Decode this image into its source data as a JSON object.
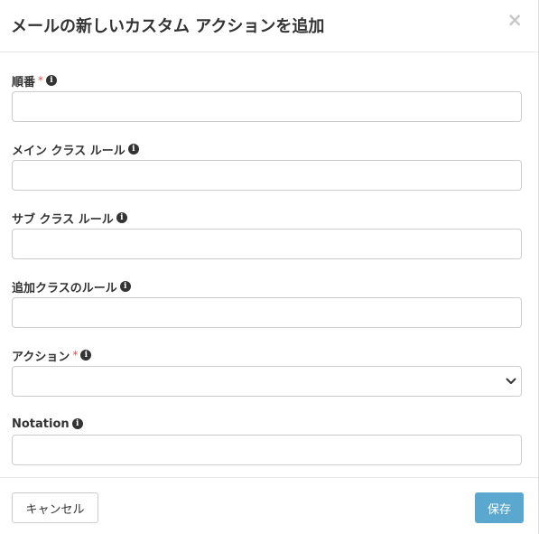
{
  "dialog": {
    "title": "メールの新しいカスタム アクションを追加",
    "close_symbol": "×"
  },
  "fields": [
    {
      "label": "順番",
      "required_mark": "*",
      "value": "",
      "type": "text"
    },
    {
      "label": "メイン クラス ルール",
      "required_mark": "",
      "value": "",
      "type": "text"
    },
    {
      "label": "サブ クラス ルール",
      "required_mark": "",
      "value": "",
      "type": "text"
    },
    {
      "label": "追加クラスのルール",
      "required_mark": "",
      "value": "",
      "type": "text"
    },
    {
      "label": "アクション",
      "required_mark": "*",
      "value": "",
      "type": "select"
    },
    {
      "label": "Notation",
      "required_mark": "",
      "value": "",
      "type": "text"
    }
  ],
  "info_icon_glyph": "i",
  "footer": {
    "cancel_label": "キャンセル",
    "save_label": "保存"
  },
  "colors": {
    "required": "#d9534f",
    "save_button": "#5aa8cf",
    "title_text": "#333333"
  }
}
